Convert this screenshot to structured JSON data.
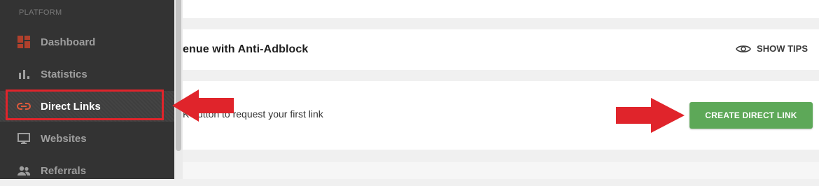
{
  "sidebar": {
    "section_label": "PLATFORM",
    "items": [
      {
        "label": "Dashboard",
        "icon": "dashboard-icon",
        "active": false
      },
      {
        "label": "Statistics",
        "icon": "bar-chart-icon",
        "active": false
      },
      {
        "label": "Direct Links",
        "icon": "link-icon",
        "active": true
      },
      {
        "label": "Websites",
        "icon": "monitor-icon",
        "active": false
      },
      {
        "label": "Referrals",
        "icon": "people-icon",
        "active": false
      }
    ]
  },
  "header": {
    "title": "enue with Anti-Adblock",
    "show_tips_label": "SHOW TIPS"
  },
  "main": {
    "instruction_text": "K button to request your first link",
    "create_button_label": "CREATE DIRECT LINK"
  },
  "colors": {
    "sidebar_bg": "#333333",
    "accent_green": "#5da858",
    "annotation_red": "#e0242b",
    "dashboard_icon": "#b0402c"
  }
}
